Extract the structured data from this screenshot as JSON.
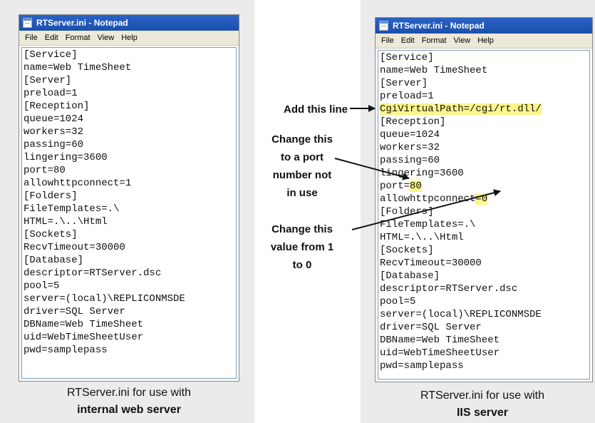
{
  "left": {
    "title": "RTServer.ini - Notepad",
    "menu": [
      "File",
      "Edit",
      "Format",
      "View",
      "Help"
    ],
    "lines": [
      "[Service]",
      "name=Web TimeSheet",
      "[Server]",
      "preload=1",
      "[Reception]",
      "queue=1024",
      "workers=32",
      "passing=60",
      "lingering=3600",
      "port=80",
      "allowhttpconnect=1",
      "[Folders]",
      "FileTemplates=.\\",
      "HTML=.\\..\\Html",
      "[Sockets]",
      "RecvTimeout=30000",
      "[Database]",
      "descriptor=RTServer.dsc",
      "pool=5",
      "server=(local)\\REPLICONMSDE",
      "driver=SQL Server",
      "DBName=Web TimeSheet",
      "uid=WebTimeSheetUser",
      "pwd=samplepass"
    ],
    "caption_line1": "RTServer.ini for use with",
    "caption_line2": "internal web server"
  },
  "right": {
    "title": "RTServer.ini - Notepad",
    "menu": [
      "File",
      "Edit",
      "Format",
      "View",
      "Help"
    ],
    "lines": [
      "[Service]",
      "name=Web TimeSheet",
      "[Server]",
      "preload=1",
      "CgiVirtualPath=/cgi/rt.dll/",
      "[Reception]",
      "queue=1024",
      "workers=32",
      "passing=60",
      "lingering=3600",
      "port=",
      "allowhttpconnect",
      "[Folders]",
      "FileTemplates=.\\",
      "HTML=.\\..\\Html",
      "[Sockets]",
      "RecvTimeout=30000",
      "[Database]",
      "descriptor=RTServer.dsc",
      "pool=5",
      "server=(local)\\REPLICONMSDE",
      "driver=SQL Server",
      "DBName=Web TimeSheet",
      "uid=WebTimeSheetUser",
      "pwd=samplepass"
    ],
    "port_value": "80",
    "allow_value": "=0",
    "caption_line1": "RTServer.ini for use with",
    "caption_line2": "IIS server"
  },
  "annotations": {
    "add_line": "Add this line",
    "change_port": [
      "Change this",
      "to a port",
      "number not",
      "in use"
    ],
    "change_value": [
      "Change this",
      "value from 1",
      "to 0"
    ]
  },
  "colors": {
    "highlight": "#fbf58a",
    "titlebar": "#2a63c6"
  }
}
